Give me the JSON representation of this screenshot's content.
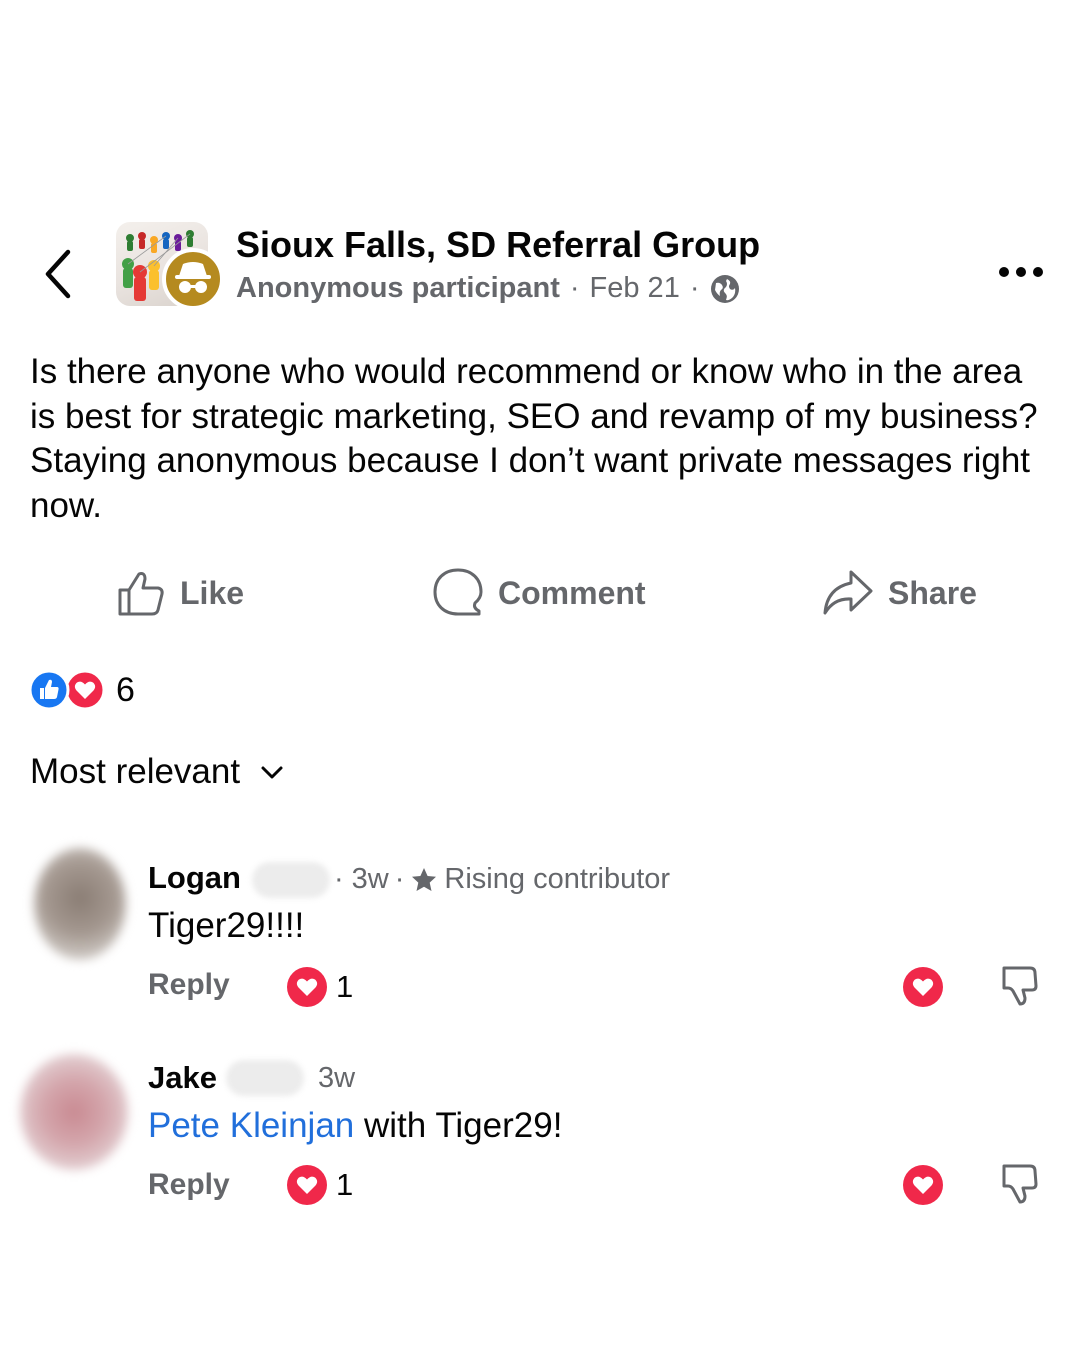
{
  "header": {
    "group_name": "Sioux Falls, SD Referral Group",
    "author": "Anonymous participant",
    "separator": "·",
    "date": "Feb 21",
    "visibility_icon": "globe-icon",
    "back_icon": "chevron-left-icon",
    "more_icon": "more-dots-icon"
  },
  "post": {
    "text": "Is there anyone who would recommend or know who in the area is best for strategic marketing, SEO and revamp of my business? Staying anonymous because I don’t want private messages right now."
  },
  "actions": {
    "like": "Like",
    "comment": "Comment",
    "share": "Share"
  },
  "reactions": {
    "count": "6",
    "types": [
      "like",
      "love"
    ]
  },
  "sort": {
    "label": "Most relevant"
  },
  "comments": [
    {
      "name": "Logan",
      "time": "3w",
      "badge": "Rising contributor",
      "text": "Tiger29!!!!",
      "reply_label": "Reply",
      "reaction_count": "1"
    },
    {
      "name": "Jake",
      "time": "3w",
      "mention": "Pete Kleinjan",
      "text": " with Tiger29!",
      "reply_label": "Reply",
      "reaction_count": "1"
    }
  ],
  "colors": {
    "mention": "#216fdb",
    "love": "#f0284a",
    "like": "#1877f2",
    "secondary_text": "#65676b"
  }
}
